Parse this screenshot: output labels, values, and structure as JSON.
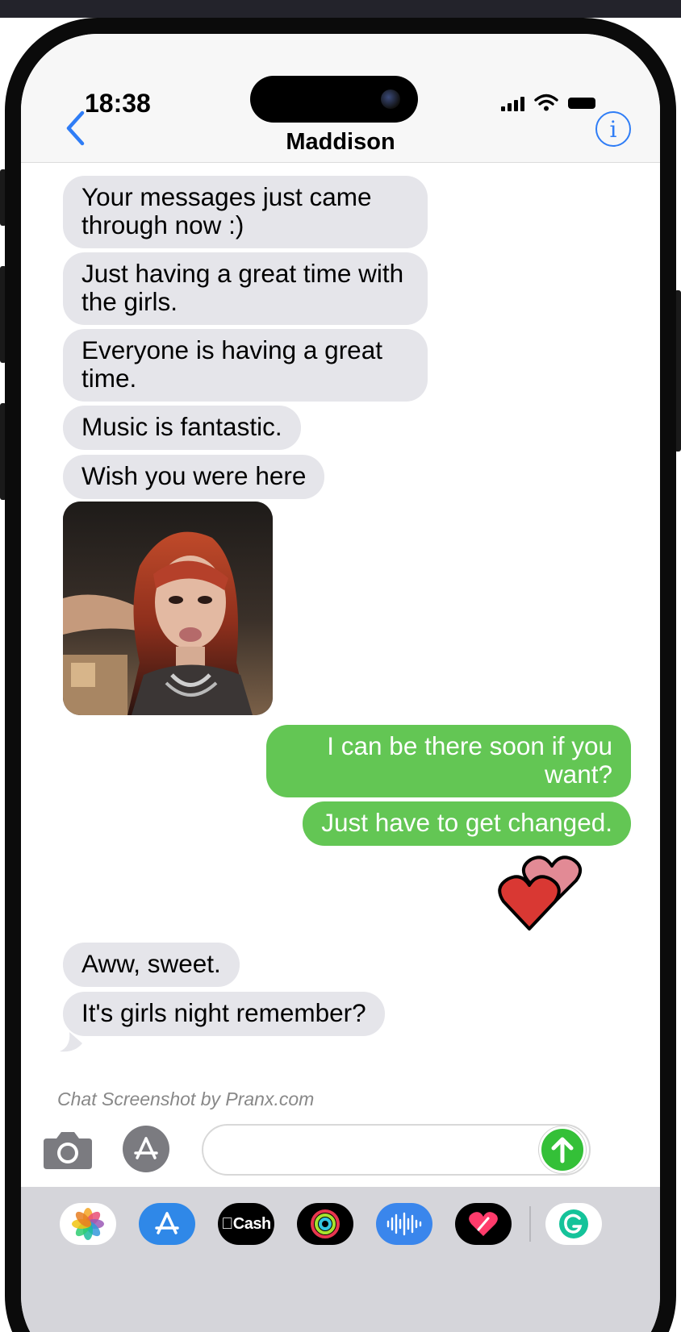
{
  "status": {
    "time": "18:38"
  },
  "header": {
    "contact_name": "Maddison",
    "info_glyph": "i"
  },
  "messages": [
    {
      "sender": "contact",
      "type": "text",
      "text": "Your messages just came through now :)"
    },
    {
      "sender": "contact",
      "type": "text",
      "text": "Just having a great time with the girls."
    },
    {
      "sender": "contact",
      "type": "text",
      "text": "Everyone is having a great time."
    },
    {
      "sender": "contact",
      "type": "text",
      "text": "Music is fantastic."
    },
    {
      "sender": "contact",
      "type": "text",
      "text": "Wish you were here"
    },
    {
      "sender": "contact",
      "type": "image"
    },
    {
      "sender": "me",
      "type": "text",
      "text": "I can be there soon if you want?"
    },
    {
      "sender": "me",
      "type": "text",
      "text": "Just have to get changed."
    },
    {
      "sender": "me",
      "type": "emoji",
      "icon": "two-hearts-icon"
    },
    {
      "sender": "contact",
      "type": "text",
      "text": "Aww, sweet."
    },
    {
      "sender": "contact",
      "type": "text",
      "text": "It's girls night remember?"
    }
  ],
  "watermark": "Chat Screenshot by Pranx.com",
  "composer": {
    "value": "",
    "placeholder": ""
  },
  "app_drawer": {
    "cash_label": "Cash",
    "apps": [
      "photos-icon",
      "app-store-icon",
      "cash-app-icon",
      "fitness-rings-icon",
      "audio-message-icon",
      "digital-touch-icon",
      "grammarly-icon"
    ]
  },
  "colors": {
    "incoming_bubble": "#e5e5ea",
    "outgoing_bubble": "#63c654",
    "accent_blue": "#2f7df6",
    "send_green": "#34c038"
  }
}
